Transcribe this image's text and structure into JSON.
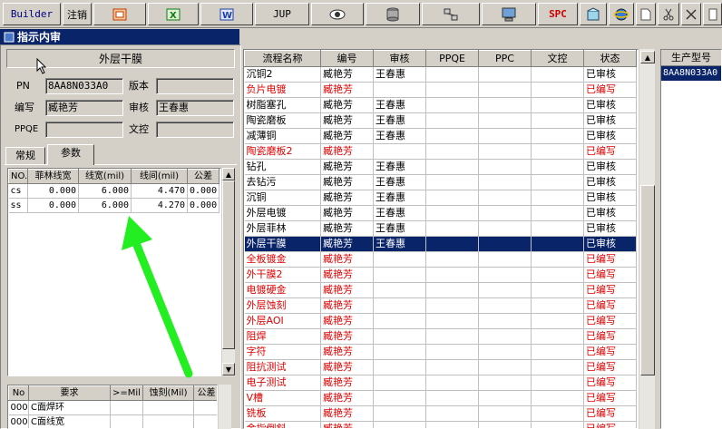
{
  "toolbar": {
    "builder": "Builder",
    "logout": "注销",
    "jup": "JUP",
    "spc": "SPC"
  },
  "window": {
    "title": "指示内审"
  },
  "left": {
    "header": "外层干膜",
    "pn_label": "PN",
    "pn_value": "8AA8N033A0",
    "version_label": "版本",
    "version_value": "",
    "author_label": "编写",
    "author_value": "臧艳芳",
    "review_label": "审核",
    "review_value": "王春惠",
    "ppqe_label": "PPQE",
    "ppqe_value": "",
    "doc_label": "文控",
    "doc_value": "",
    "tabs": [
      "常规",
      "参数"
    ],
    "params": {
      "headers": [
        "NO.",
        "菲林线宽",
        "线宽(mil)",
        "线间(mil)",
        "公差"
      ],
      "rows": [
        [
          "cs",
          "0.000",
          "6.000",
          "4.470",
          "0.000"
        ],
        [
          "ss",
          "0.000",
          "6.000",
          "4.270",
          "0.000"
        ]
      ]
    },
    "reqs": {
      "headers": [
        "No",
        "要求",
        ">=Mil",
        "蚀刻(Mil)",
        "公差"
      ],
      "rows": [
        [
          "000",
          "C面焊环",
          "",
          "",
          ""
        ],
        [
          "000",
          "C面线宽",
          "",
          "",
          ""
        ]
      ]
    }
  },
  "flow": {
    "headers": [
      "流程名称",
      "编号",
      "审核",
      "PPQE",
      "PPC",
      "文控",
      "状态"
    ],
    "rows": [
      {
        "name": "沉铜2",
        "code": "臧艳芳",
        "review": "王春惠",
        "status": "已审核",
        "red": false,
        "sel": false
      },
      {
        "name": "负片电镀",
        "code": "臧艳芳",
        "review": "",
        "status": "已编写",
        "red": true,
        "sel": false
      },
      {
        "name": "树脂塞孔",
        "code": "臧艳芳",
        "review": "王春惠",
        "status": "已审核",
        "red": false,
        "sel": false
      },
      {
        "name": "陶瓷磨板",
        "code": "臧艳芳",
        "review": "王春惠",
        "status": "已审核",
        "red": false,
        "sel": false
      },
      {
        "name": "减薄铜",
        "code": "臧艳芳",
        "review": "王春惠",
        "status": "已审核",
        "red": false,
        "sel": false
      },
      {
        "name": "陶瓷磨板2",
        "code": "臧艳芳",
        "review": "",
        "status": "已编写",
        "red": true,
        "sel": false
      },
      {
        "name": "钻孔",
        "code": "臧艳芳",
        "review": "王春惠",
        "status": "已审核",
        "red": false,
        "sel": false
      },
      {
        "name": "去钻污",
        "code": "臧艳芳",
        "review": "王春惠",
        "status": "已审核",
        "red": false,
        "sel": false
      },
      {
        "name": "沉铜",
        "code": "臧艳芳",
        "review": "王春惠",
        "status": "已审核",
        "red": false,
        "sel": false
      },
      {
        "name": "外层电镀",
        "code": "臧艳芳",
        "review": "王春惠",
        "status": "已审核",
        "red": false,
        "sel": false
      },
      {
        "name": "外层菲林",
        "code": "臧艳芳",
        "review": "王春惠",
        "status": "已审核",
        "red": false,
        "sel": false
      },
      {
        "name": "外层干膜",
        "code": "臧艳芳",
        "review": "王春惠",
        "status": "已审核",
        "red": false,
        "sel": true
      },
      {
        "name": "全板镀金",
        "code": "臧艳芳",
        "review": "",
        "status": "已编写",
        "red": true,
        "sel": false
      },
      {
        "name": "外干膜2",
        "code": "臧艳芳",
        "review": "",
        "status": "已编写",
        "red": true,
        "sel": false
      },
      {
        "name": "电镀硬金",
        "code": "臧艳芳",
        "review": "",
        "status": "已编写",
        "red": true,
        "sel": false
      },
      {
        "name": "外层蚀刻",
        "code": "臧艳芳",
        "review": "",
        "status": "已编写",
        "red": true,
        "sel": false
      },
      {
        "name": "外层AOI",
        "code": "臧艳芳",
        "review": "",
        "status": "已编写",
        "red": true,
        "sel": false
      },
      {
        "name": "阻焊",
        "code": "臧艳芳",
        "review": "",
        "status": "已编写",
        "red": true,
        "sel": false
      },
      {
        "name": "字符",
        "code": "臧艳芳",
        "review": "",
        "status": "已编写",
        "red": true,
        "sel": false
      },
      {
        "name": "阻抗测试",
        "code": "臧艳芳",
        "review": "",
        "status": "已编写",
        "red": true,
        "sel": false
      },
      {
        "name": "电子测试",
        "code": "臧艳芳",
        "review": "",
        "status": "已编写",
        "red": true,
        "sel": false
      },
      {
        "name": "V槽",
        "code": "臧艳芳",
        "review": "",
        "status": "已编写",
        "red": true,
        "sel": false
      },
      {
        "name": "铣板",
        "code": "臧艳芳",
        "review": "",
        "status": "已编写",
        "red": true,
        "sel": false
      },
      {
        "name": "金指倒斜",
        "code": "臧艳芳",
        "review": "",
        "status": "已编写",
        "red": true,
        "sel": false
      }
    ]
  },
  "product": {
    "header": "生产型号",
    "value": "8AA8N033A0"
  },
  "colors": {
    "selection": "#0a246a",
    "written": "#e00000",
    "arrow": "#22ee22"
  }
}
